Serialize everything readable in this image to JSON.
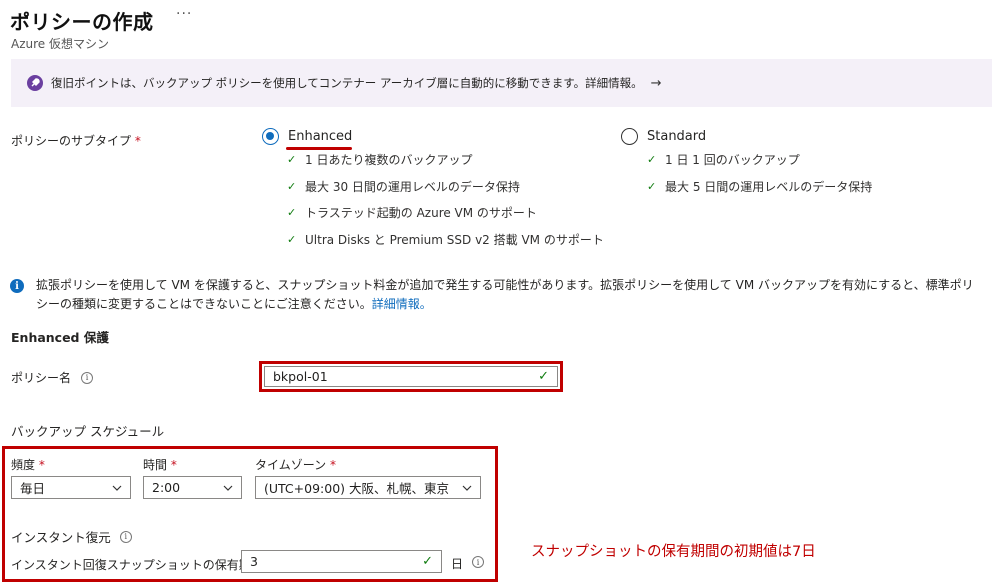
{
  "header": {
    "title": "ポリシーの作成",
    "more": "···",
    "subtitle": "Azure 仮想マシン"
  },
  "banner": {
    "text": "復旧ポイントは、バックアップ ポリシーを使用してコンテナー アーカイブ層に自動的に移動できます。詳細情報。",
    "arrow": "→"
  },
  "subtype": {
    "label": "ポリシーのサブタイプ",
    "required": "*",
    "enhanced": {
      "label": "Enhanced",
      "selected": true,
      "features": [
        "1 日あたり複数のバックアップ",
        "最大 30 日間の運用レベルのデータ保持",
        "トラステッド起動の Azure VM のサポート",
        "Ultra Disks と Premium SSD v2 搭載 VM のサポート"
      ]
    },
    "standard": {
      "label": "Standard",
      "selected": false,
      "features": [
        "1 日 1 回のバックアップ",
        "最大 5 日間の運用レベルのデータ保持"
      ]
    }
  },
  "info": {
    "text": "拡張ポリシーを使用して VM を保護すると、スナップショット料金が追加で発生する可能性があります。拡張ポリシーを使用して VM バックアップを有効にすると、標準ポリシーの種類に変更することはできないことにご注意ください。",
    "link": "詳細情報。"
  },
  "enhanced_section": {
    "heading": "Enhanced 保護",
    "policy_name_label": "ポリシー名",
    "policy_name_value": "bkpol-01"
  },
  "schedule": {
    "heading": "バックアップ スケジュール",
    "frequency_label": "頻度",
    "frequency_value": "毎日",
    "time_label": "時間",
    "time_value": "2:00",
    "timezone_label": "タイムゾーン",
    "timezone_value": "(UTC+09:00) 大阪、札幌、東京",
    "required": "*"
  },
  "instant_restore": {
    "heading": "インスタント復元",
    "retention_label": "インスタント回復スナップショットの保有期間",
    "retention_value": "3",
    "unit": "日"
  },
  "annotation": "スナップショットの保有期間の初期値は7日",
  "colors": {
    "accent": "#0f6cbd",
    "highlight": "#c00000",
    "success": "#107c10",
    "banner_bg": "#f4f0f8"
  }
}
